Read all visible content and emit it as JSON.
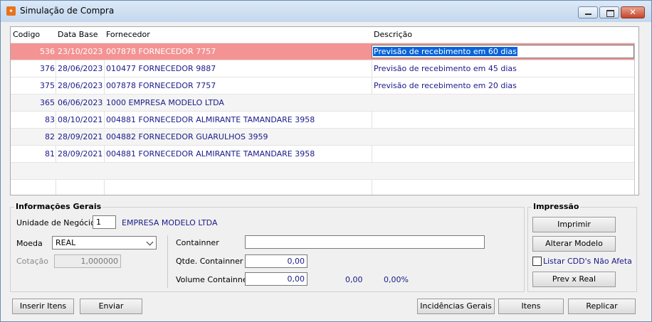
{
  "window": {
    "title": "Simulação de Compra",
    "icon": "app-logo-icon"
  },
  "grid": {
    "columns": [
      "Codigo",
      "Data Base",
      "Fornecedor",
      "Descrição"
    ],
    "rows": [
      {
        "codigo": "536",
        "data_base": "23/10/2023",
        "fornecedor": "007878  FORNECEDOR   7757",
        "descricao": "Previsão de recebimento em 60 dias",
        "selected": true
      },
      {
        "codigo": "376",
        "data_base": "28/06/2023",
        "fornecedor": "010477  FORNECEDOR   9887",
        "descricao": "Previsão de recebimento em 45 dias"
      },
      {
        "codigo": "375",
        "data_base": "28/06/2023",
        "fornecedor": "007878  FORNECEDOR   7757",
        "descricao": "Previsão de recebimento em 20 dias"
      },
      {
        "codigo": "365",
        "data_base": "06/06/2023",
        "fornecedor": "1000    EMPRESA MODELO LTDA",
        "descricao": ""
      },
      {
        "codigo": "83",
        "data_base": "08/10/2021",
        "fornecedor": "004881  FORNECEDOR ALMIRANTE TAMANDARE 3958",
        "descricao": ""
      },
      {
        "codigo": "82",
        "data_base": "28/09/2021",
        "fornecedor": "004882  FORNECEDOR GUARULHOS 3959",
        "descricao": ""
      },
      {
        "codigo": "81",
        "data_base": "28/09/2021",
        "fornecedor": "004881  FORNECEDOR ALMIRANTE TAMANDARE 3958",
        "descricao": ""
      }
    ]
  },
  "info": {
    "title": "Informações Gerais",
    "unidade_label": "Unidade de Negócio",
    "unidade_value": "1",
    "unidade_name": "EMPRESA MODELO LTDA",
    "moeda_label": "Moeda",
    "moeda_value": "REAL",
    "cotacao_label": "Cotação",
    "cotacao_value": "1,000000",
    "containner_label": "Containner",
    "containner_value": "",
    "qtde_label": "Qtde. Containner",
    "qtde_value": "0,00",
    "volume_label": "Volume Containner",
    "volume_value": "0,00",
    "volume_total": "0,00",
    "volume_pct": "0,00%"
  },
  "impressao": {
    "title": "Impressão",
    "imprimir": "Imprimir",
    "alterar_modelo": "Alterar Modelo",
    "listar_cdd": "Listar CDD's Não Afeta",
    "prev_real": "Prev x Real"
  },
  "footer": {
    "inserir_itens": "Inserir Itens",
    "enviar": "Enviar",
    "incidencias": "Incidências Gerais",
    "itens": "Itens",
    "replicar": "Replicar"
  },
  "colors": {
    "selected_row": "#f49393",
    "value_text": "#1a1a8a",
    "selection_highlight": "#0a64d8"
  }
}
